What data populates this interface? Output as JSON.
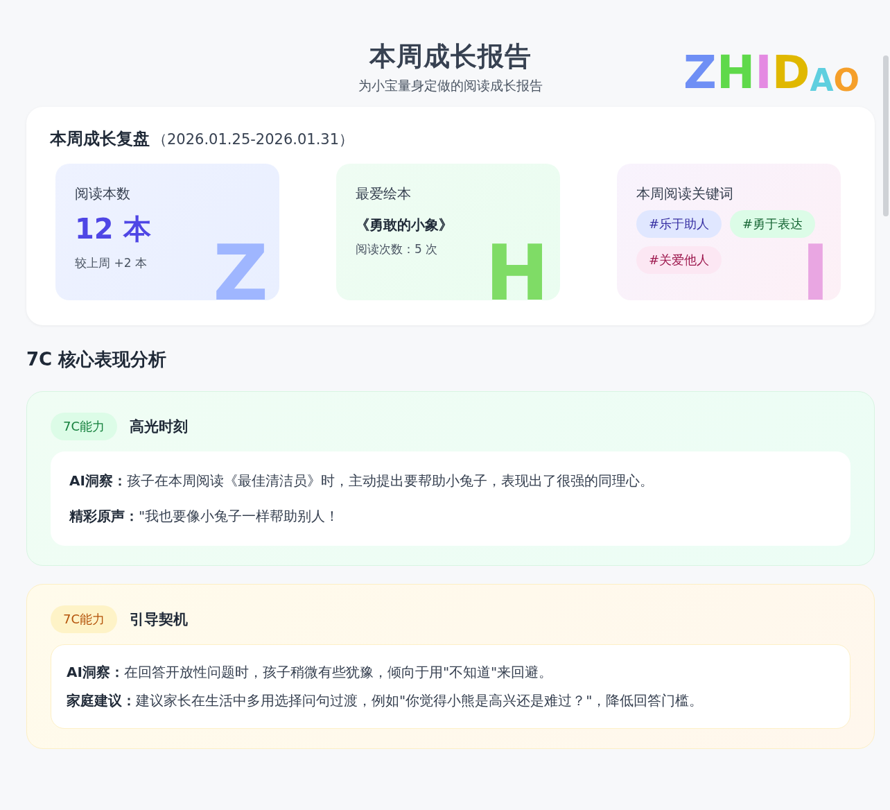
{
  "header": {
    "title": "本周成长报告",
    "subtitle": "为小宝量身定做的阅读成长报告",
    "logo": "ZHIDAO"
  },
  "review": {
    "title": "本周成长复盘",
    "period": "（2026.01.25-2026.01.31）",
    "cards": [
      {
        "kind": "count",
        "label": "阅读本数",
        "value": "12 本",
        "note": "较上周 +2 本",
        "mascot": "Z"
      },
      {
        "kind": "book",
        "label": "最爱绘本",
        "value": "《勇敢的小象》",
        "note": "阅读次数：5 次",
        "mascot": "H"
      },
      {
        "kind": "keywords",
        "label": "本周阅读关键词",
        "mascot": "I",
        "tags": [
          {
            "text": "#乐于助人",
            "color": "#3730a3"
          },
          {
            "text": "#勇于表达",
            "color": "#166534"
          },
          {
            "text": "#关爱他人",
            "color": "#9d174d"
          }
        ]
      }
    ]
  },
  "analysis": {
    "title": "7C 核心表现分析",
    "cards": [
      {
        "kind": "highlight",
        "tag": "7C能力",
        "title": "高光时刻",
        "lines": [
          {
            "label": "AI洞察：",
            "text": "孩子在本周阅读《最佳清洁员》时，主动提出要帮助小兔子，表现出了很强的同理心。"
          },
          {
            "label": "精彩原声：",
            "text": "\"我也要像小兔子一样帮助别人！"
          }
        ]
      },
      {
        "kind": "guidance",
        "tag": "7C能力",
        "title": "引导契机",
        "lines": [
          {
            "label": "AI洞察：",
            "text": "在回答开放性问题时，孩子稍微有些犹豫，倾向于用\"不知道\"来回避。"
          },
          {
            "label": "家庭建议：",
            "text": "建议家长在生活中多用选择问句过渡，例如\"你觉得小熊是高兴还是难过？\"，降低回答门槛。"
          }
        ]
      }
    ]
  }
}
